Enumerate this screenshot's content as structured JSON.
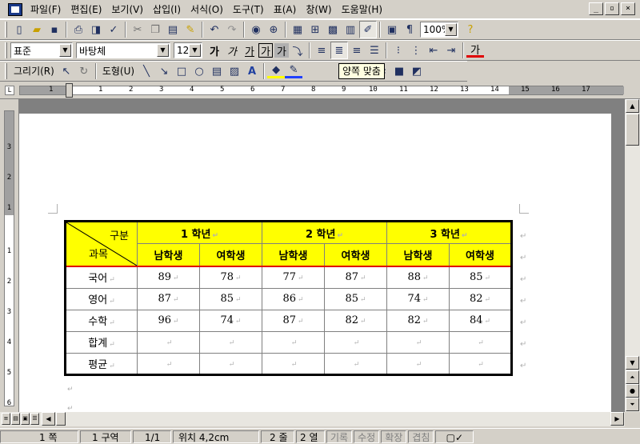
{
  "menubar": {
    "items": [
      "파일(F)",
      "편집(E)",
      "보기(V)",
      "삽입(I)",
      "서식(O)",
      "도구(T)",
      "표(A)",
      "창(W)",
      "도움말(H)"
    ]
  },
  "toolbar": {
    "zoom": "100%",
    "style_combo": "표준",
    "font_combo": "바탕체",
    "size_combo": "12",
    "bold": "가",
    "italic": "가",
    "underline": "가",
    "border_char": "가",
    "shade_char": "가",
    "draw_label": "그리기(R)",
    "shape_label": "도형(U)",
    "font_color_label": "가"
  },
  "tooltip": "양쪽 맞춤",
  "ruler": {
    "numbers": [
      "1",
      "1",
      "2",
      "3",
      "4",
      "5",
      "6",
      "7",
      "8",
      "9",
      "10",
      "11",
      "12",
      "13",
      "14",
      "15",
      "16",
      "17"
    ]
  },
  "table": {
    "corner_top": "구분",
    "corner_bottom": "과목",
    "grades": [
      "1 학년",
      "2 학년",
      "3 학년"
    ],
    "sub_headers": [
      "남학생",
      "여학생",
      "남학생",
      "여학생",
      "남학생",
      "여학생"
    ],
    "rows": [
      {
        "subject": "국어",
        "values": [
          "89",
          "78",
          "77",
          "87",
          "88",
          "85"
        ]
      },
      {
        "subject": "영어",
        "values": [
          "87",
          "85",
          "86",
          "85",
          "74",
          "82"
        ]
      },
      {
        "subject": "수학",
        "values": [
          "96",
          "74",
          "87",
          "82",
          "82",
          "84"
        ]
      },
      {
        "subject": "합계",
        "values": [
          "",
          "",
          "",
          "",
          "",
          ""
        ]
      },
      {
        "subject": "평균",
        "values": [
          "",
          "",
          "",
          "",
          "",
          ""
        ]
      }
    ]
  },
  "statusbar": {
    "page": "1 쪽",
    "section": "1 구역",
    "pages": "1/1",
    "position": "위치 4,2cm",
    "line": "2 줄",
    "column": "2 열",
    "rec": "기록",
    "trk": "수정",
    "ext": "확장",
    "ovr": "겹침"
  },
  "colors": {
    "header_fill": "#ffff00",
    "header_rule": "#e00000"
  }
}
